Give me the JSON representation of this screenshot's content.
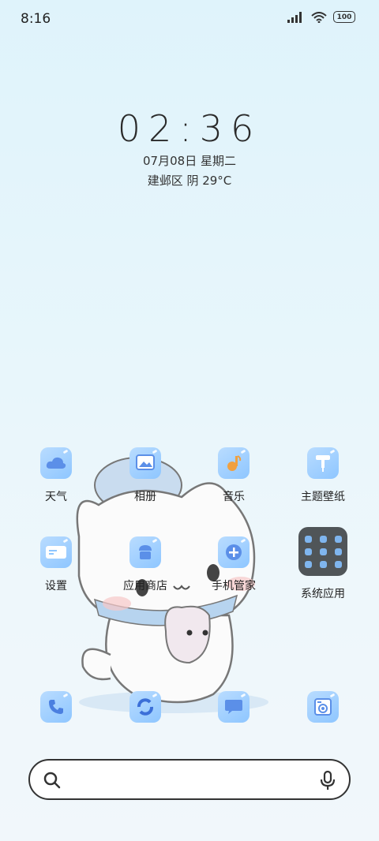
{
  "status_bar": {
    "time": "8:16",
    "battery": "100",
    "icons": [
      "signal-icon",
      "wifi-icon",
      "battery-icon"
    ]
  },
  "clock": {
    "time": "02:36",
    "date": "07月08日 星期二",
    "weather": "建邺区 阴 29°C"
  },
  "apps": [
    {
      "label": "天气",
      "icon": "weather-icon"
    },
    {
      "label": "相册",
      "icon": "gallery-icon"
    },
    {
      "label": "音乐",
      "icon": "music-icon"
    },
    {
      "label": "主题壁纸",
      "icon": "theme-icon"
    },
    {
      "label": "设置",
      "icon": "settings-icon"
    },
    {
      "label": "应用商店",
      "icon": "app-store-icon"
    },
    {
      "label": "手机管家",
      "icon": "security-icon"
    },
    {
      "label": "系统应用",
      "icon": "system-apps-folder-icon"
    }
  ],
  "dock": [
    {
      "icon": "phone-icon"
    },
    {
      "icon": "browser-icon"
    },
    {
      "icon": "messages-icon"
    },
    {
      "icon": "camera-icon"
    }
  ],
  "colors": {
    "accent": "#8ec6ff",
    "folder": "#505558",
    "background": "#e8f6fb"
  }
}
